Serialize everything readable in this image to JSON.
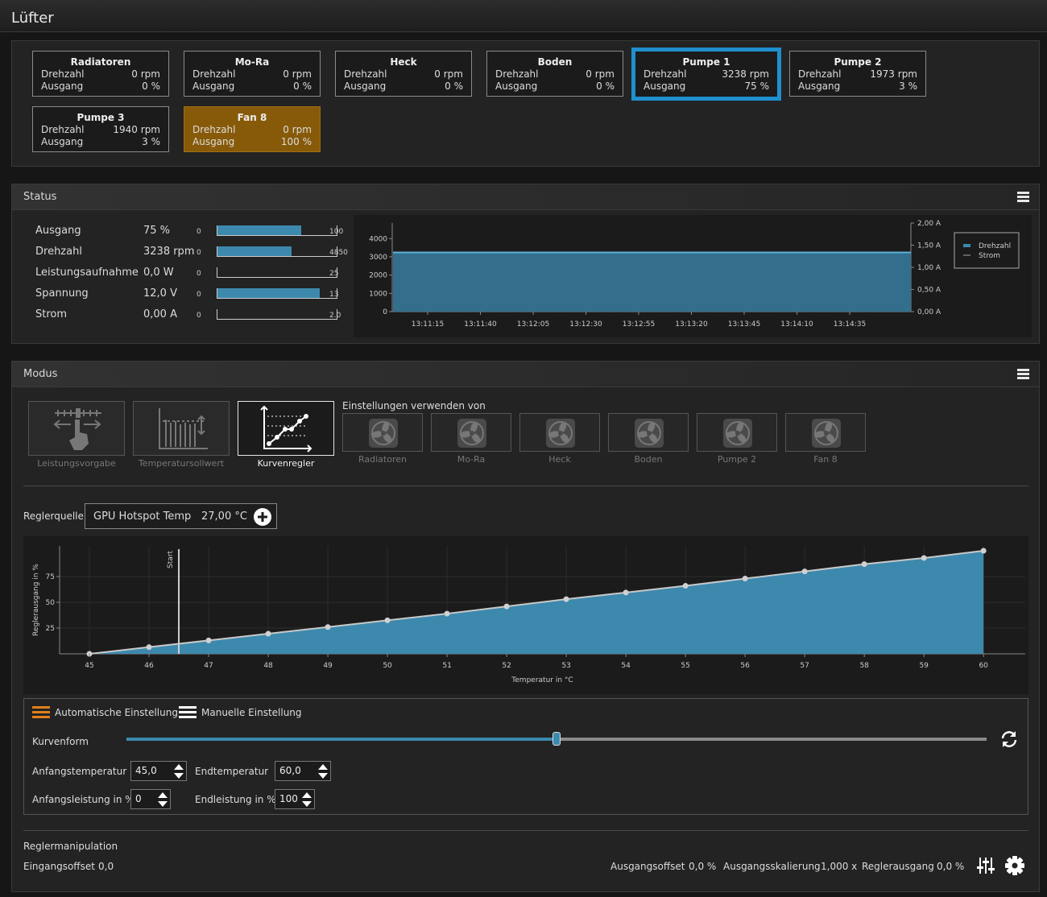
{
  "title": "Lüfter",
  "fans": [
    {
      "name": "Radiatoren",
      "speed_label": "Drehzahl",
      "speed": "0 rpm",
      "out_label": "Ausgang",
      "out": "0 %"
    },
    {
      "name": "Mo-Ra",
      "speed_label": "Drehzahl",
      "speed": "0 rpm",
      "out_label": "Ausgang",
      "out": "0 %"
    },
    {
      "name": "Heck",
      "speed_label": "Drehzahl",
      "speed": "0 rpm",
      "out_label": "Ausgang",
      "out": "0 %"
    },
    {
      "name": "Boden",
      "speed_label": "Drehzahl",
      "speed": "0 rpm",
      "out_label": "Ausgang",
      "out": "0 %"
    },
    {
      "name": "Pumpe 1",
      "speed_label": "Drehzahl",
      "speed": "3238 rpm",
      "out_label": "Ausgang",
      "out": "75 %"
    },
    {
      "name": "Pumpe 2",
      "speed_label": "Drehzahl",
      "speed": "1973 rpm",
      "out_label": "Ausgang",
      "out": "3 %"
    },
    {
      "name": "Pumpe 3",
      "speed_label": "Drehzahl",
      "speed": "1940 rpm",
      "out_label": "Ausgang",
      "out": "3 %"
    },
    {
      "name": "Fan 8",
      "speed_label": "Drehzahl",
      "speed": "0 rpm",
      "out_label": "Ausgang",
      "out": "100 %"
    }
  ],
  "status": {
    "title": "Status",
    "rows": [
      {
        "label": "Ausgang",
        "value": "75 %",
        "min": "0",
        "max": "100",
        "level": 0.75
      },
      {
        "label": "Drehzahl",
        "value": "3238 rpm",
        "min": "0",
        "max": "4850",
        "level": 0.667
      },
      {
        "label": "Leistungsaufnahme",
        "value": "0,0 W",
        "min": "0",
        "max": "25",
        "level": 0
      },
      {
        "label": "Spannung",
        "value": "12,0 V",
        "min": "0",
        "max": "13",
        "level": 0.923
      },
      {
        "label": "Strom",
        "value": "0,00 A",
        "min": "0",
        "max": "2.0",
        "level": 0
      }
    ],
    "chart": {
      "y_ticks": [
        "4000",
        "3000",
        "2000",
        "1000",
        "0"
      ],
      "y2_ticks": [
        "2,00 A",
        "1,50 A",
        "1,00 A",
        "0,50 A",
        "0,00 A"
      ],
      "x_ticks": [
        "13:11:15",
        "13:11:40",
        "13:12:05",
        "13:12:30",
        "13:12:55",
        "13:13:20",
        "13:13:45",
        "13:14:10",
        "13:14:35"
      ],
      "legend": [
        "Drehzahl",
        "Strom"
      ],
      "value": 3238,
      "ymax": 4850
    }
  },
  "modus": {
    "title": "Modus",
    "modes": [
      "Leistungsvorgabe",
      "Temperatursollwert",
      "Kurvenregler"
    ],
    "settings_from": "Einstellungen verwenden von",
    "sources": [
      "Radiatoren",
      "Mo-Ra",
      "Heck",
      "Boden",
      "Pumpe 2",
      "Fan 8"
    ],
    "regler_label": "Reglerquelle",
    "regler_source": "GPU Hotspot Temp",
    "regler_temp": "27,00 °C",
    "auto_label": "Automatische Einstellung",
    "manual_label": "Manuelle Einstellung",
    "kurvenform_label": "Kurvenform",
    "kurvenform_level": 0.5,
    "start_temp_label": "Anfangstemperatur",
    "start_temp": "45,0",
    "end_temp_label": "Endtemperatur",
    "end_temp": "60,0",
    "start_power_label": "Anfangsleistung in %",
    "start_power": "0",
    "end_power_label": "Endleistung in %",
    "end_power": "100",
    "manip_title": "Reglermanipulation",
    "in_offset_label": "Eingangsoffset",
    "in_offset": "0,0",
    "out_offset_label": "Ausgangsoffset",
    "out_offset": "0,0 %",
    "out_scale_label": "Ausgangsskalierung",
    "out_scale": "1,000 x",
    "regler_out_label": "Reglerausgang",
    "regler_out": "0,0 %"
  },
  "chart_data": {
    "type": "area",
    "xlabel": "Temperatur in °C",
    "ylabel": "Reglerausgang in %",
    "start_label": "Start",
    "start_x": 46.5,
    "x": [
      45,
      46,
      47,
      48,
      49,
      50,
      51,
      52,
      53,
      54,
      55,
      56,
      57,
      58,
      59,
      60
    ],
    "values": [
      0,
      6.5,
      13,
      19.5,
      26,
      32.5,
      39,
      46,
      53,
      59.5,
      66,
      73,
      80,
      87,
      93,
      100
    ],
    "x_ticks": [
      "45",
      "46",
      "47",
      "48",
      "49",
      "50",
      "51",
      "52",
      "53",
      "54",
      "55",
      "56",
      "57",
      "58",
      "59",
      "60"
    ],
    "y_ticks": [
      "75",
      "50",
      "25"
    ],
    "xlim": [
      44.5,
      60.7
    ],
    "ylim": [
      0,
      100
    ]
  },
  "colors": {
    "accent": "#1f8fce",
    "fill": "#3d89ad",
    "orange": "#875a0a",
    "icon_orange": "#e0801a"
  }
}
